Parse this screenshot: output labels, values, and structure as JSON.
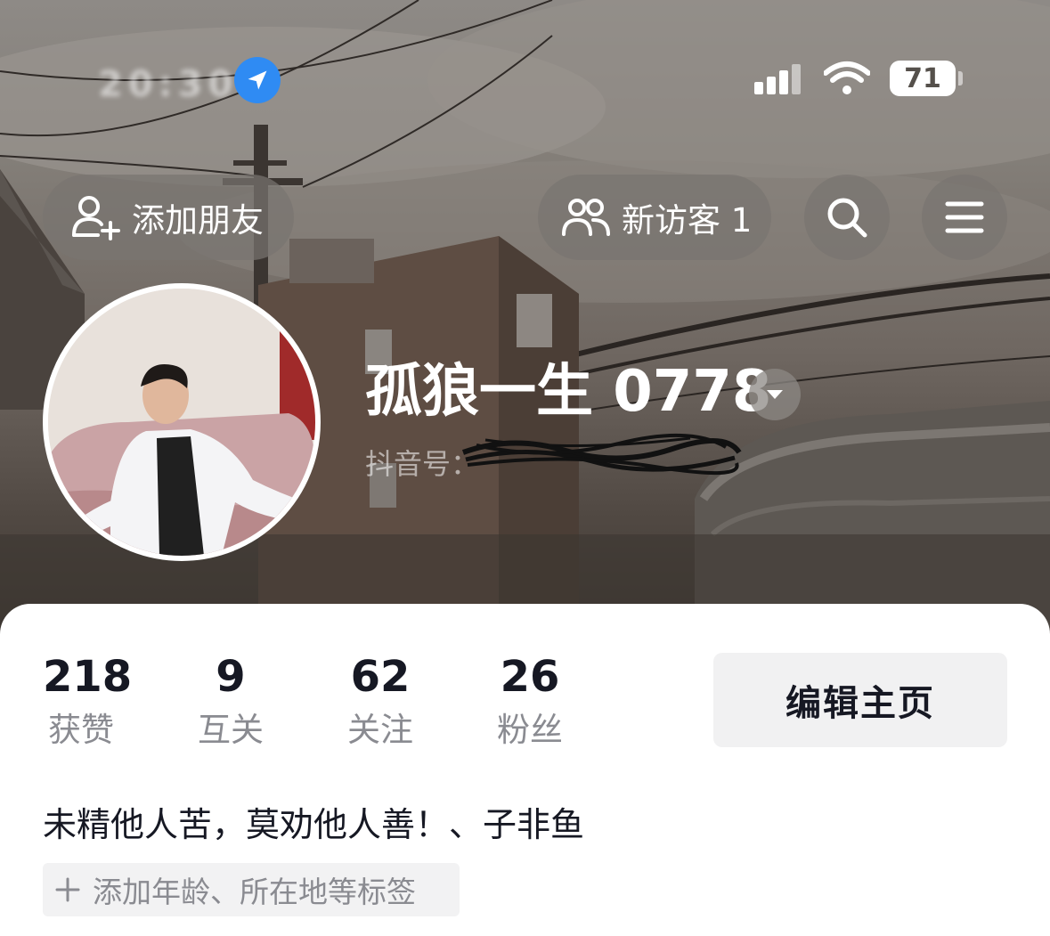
{
  "status_bar": {
    "time": "20:30",
    "battery": "71",
    "icons": [
      "location-arrow-icon",
      "cellular-signal-icon",
      "wifi-icon",
      "battery-icon"
    ]
  },
  "header": {
    "add_friend_label": "添加朋友",
    "visitors_label": "新访客 1",
    "icons": [
      "add-user-icon",
      "visitors-icon",
      "search-icon",
      "menu-icon"
    ]
  },
  "profile": {
    "nickname": "孤狼一生 0778",
    "douyin_id_label": "抖音号："
  },
  "stats": [
    {
      "value": "218",
      "label": "获赞"
    },
    {
      "value": "9",
      "label": "互关"
    },
    {
      "value": "62",
      "label": "关注"
    },
    {
      "value": "26",
      "label": "粉丝"
    }
  ],
  "edit_profile_label": "编辑主页",
  "bio": "未精他人苦，莫劝他人善！、子非鱼",
  "add_tags_label": "添加年龄、所在地等标签",
  "colors": {
    "text_primary": "#161823",
    "text_secondary": "#8a8b91",
    "location_blue": "#2f8bf3",
    "button_bg": "#f1f1f2"
  }
}
